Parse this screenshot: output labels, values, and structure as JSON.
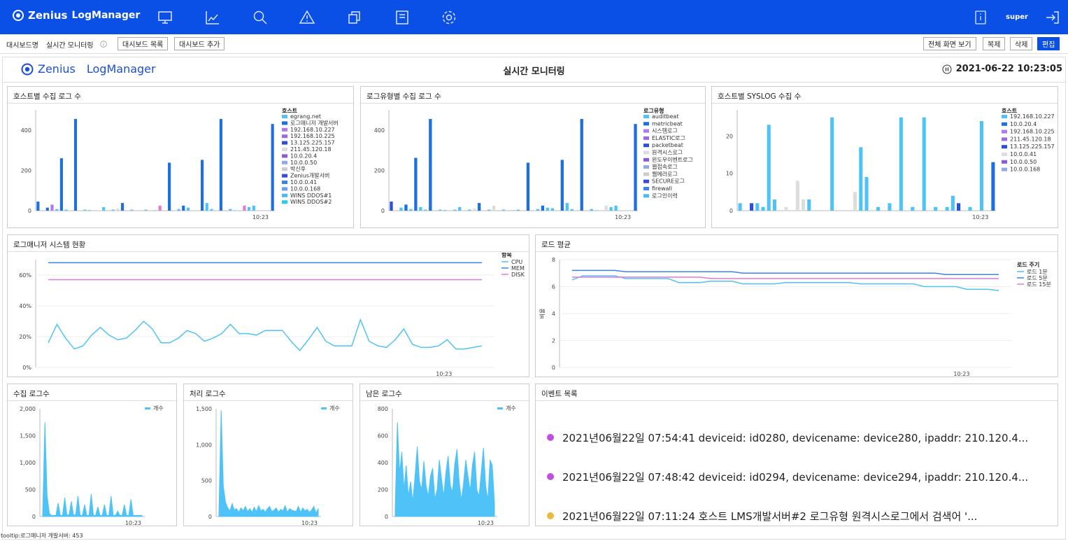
{
  "app": {
    "brand": "Zenius",
    "product": "LogManager",
    "user": "super",
    "accent": "#0a4fe6"
  },
  "nav_icons": [
    "monitor-icon",
    "line-chart-icon",
    "search-icon",
    "warning-icon",
    "copy-icon",
    "document-icon",
    "gear-icon"
  ],
  "toolbar": {
    "dashboard_label": "대시보드명",
    "dashboard_name": "실시간 모니터링",
    "list_button": "대시보드 목록",
    "add_button": "대시보드 추가",
    "fullscreen_button": "전체 화면 보기",
    "copy_button": "복제",
    "delete_button": "삭제",
    "edit_button": "편집"
  },
  "dashboard": {
    "logo_brand": "Zenius",
    "logo_product": "LogManager",
    "title": "실시간 모니터링",
    "datetime": "2021-06-22 10:23:05"
  },
  "panels": {
    "host_logs": "호스트별 수집 로그 수",
    "type_logs": "로그유형별 수집 로그 수",
    "syslog": "호스트별 SYSLOG 수집 수",
    "system": "로그매니저 시스템 현황",
    "load": "로드 평균",
    "collected": "수집 로그수",
    "processed": "처리 로그수",
    "remaining": "남은 로그수",
    "events": "이벤트 목록"
  },
  "events": [
    {
      "text": "2021년06월22일 07:54:41 deviceid: id0280, devicename: device280, ipaddr: 210.120.4...",
      "color": "#c04ee0"
    },
    {
      "text": "2021년06월22일 07:48:42 deviceid: id0294, devicename: device294, ipaddr: 210.120.4...",
      "color": "#c04ee0"
    },
    {
      "text": "2021년06월22일 07:11:24 호스트 LMS개발서버#2 로그유형 원격시스로그에서 검색어 '...",
      "color": "#f0b93a"
    }
  ],
  "tooltip": "tooltip:로그매니저 개발서버: 453",
  "chart_data": [
    {
      "id": "host_logs",
      "type": "bar",
      "xtick": "10:23",
      "ylim": [
        0,
        500
      ],
      "yticks": [
        0,
        200,
        400
      ],
      "legend_title": "호스트",
      "legend": [
        "egrang.net",
        "로그매니저 개발서버",
        "192.168.10.227",
        "192.168.10.225",
        "13.125.225.157",
        "211.45.120.18",
        "10.0.20.4",
        "10.0.0.50",
        "박신후",
        "Zenius개발서버",
        "10.0.0.41",
        "10.0.0.168",
        "WINS DDOS#1",
        "WINS DDOS#2"
      ],
      "legend_colors": [
        "#4fc3f7",
        "#1e6fe0",
        "#b07ae8",
        "#9b6be0",
        "#2a4fd9",
        "#dddddd",
        "#8a5ad8",
        "#8fa8e8",
        "#cccccc",
        "#3a4ae0",
        "#3a82f0",
        "#6aa0f0",
        "#4fb8f0",
        "#23d0e8"
      ],
      "values": [
        45,
        0,
        15,
        30,
        8,
        260,
        5,
        0,
        455,
        0,
        5,
        3,
        0,
        2,
        18,
        0,
        5,
        10,
        38,
        0,
        5,
        3,
        0,
        5,
        0,
        2,
        25,
        0,
        238,
        0,
        8,
        25,
        15,
        0,
        0,
        252,
        38,
        8,
        0,
        455,
        0,
        8,
        2,
        0,
        25,
        18,
        25,
        0,
        0,
        0,
        430
      ],
      "colors": [
        "#1e6fe0",
        "#fff",
        "#1e6fe0",
        "#b07ae8",
        "#4fc3f7",
        "#1e6fe0",
        "#4fc3f7",
        "#fff",
        "#1e6fe0",
        "#fff",
        "#4fc3f7",
        "#4fc3f7",
        "#fff",
        "#dddddd",
        "#4fc3f7",
        "#fff",
        "#4fc3f7",
        "#dddddd",
        "#1e6fe0",
        "#fff",
        "#4fc3f7",
        "#dddddd",
        "#fff",
        "#4fc3f7",
        "#fff",
        "#4fc3f7",
        "#e07ad8",
        "#fff",
        "#1e6fe0",
        "#fff",
        "#4fc3f7",
        "#1e6fe0",
        "#4fc3f7",
        "#fff",
        "#fff",
        "#1e6fe0",
        "#4fc3f7",
        "#4fc3f7",
        "#fff",
        "#1e6fe0",
        "#fff",
        "#4fc3f7",
        "#4fc3f7",
        "#fff",
        "#e07ad8",
        "#4fc3f7",
        "#4fc3f7",
        "#fff",
        "#fff",
        "#fff",
        "#1e6fe0"
      ]
    },
    {
      "id": "type_logs",
      "type": "bar",
      "xtick": "10:23",
      "ylim": [
        0,
        500
      ],
      "yticks": [
        0,
        200,
        400
      ],
      "legend_title": "로그유형",
      "legend": [
        "auditbeat",
        "metricbeat",
        "시스템로그",
        "ELASTIC로그",
        "packetbeat",
        "원격시스로그",
        "윈도우이벤트로그",
        "웹접속로그",
        "웹에러로그",
        "SECURE로그",
        "firewall",
        "로그인이력"
      ],
      "legend_colors": [
        "#4fc3f7",
        "#1e6fe0",
        "#b07ae8",
        "#9b6be0",
        "#2a4fd9",
        "#dddddd",
        "#8a5ad8",
        "#8fa8e8",
        "#cccccc",
        "#3a4ae0",
        "#3a82f0",
        "#4fb8f0"
      ],
      "values": [
        45,
        0,
        15,
        30,
        8,
        262,
        18,
        5,
        455,
        0,
        5,
        3,
        0,
        5,
        18,
        0,
        5,
        10,
        38,
        0,
        5,
        25,
        0,
        5,
        0,
        2,
        5,
        0,
        238,
        0,
        8,
        25,
        15,
        12,
        0,
        252,
        38,
        8,
        0,
        455,
        0,
        8,
        2,
        0,
        25,
        18,
        25,
        0,
        0,
        0,
        430
      ],
      "colors": [
        "#2a4fd9",
        "#fff",
        "#4fc3f7",
        "#1e6fe0",
        "#4fc3f7",
        "#1e6fe0",
        "#4fc3f7",
        "#4fc3f7",
        "#1e6fe0",
        "#fff",
        "#4fc3f7",
        "#4fc3f7",
        "#fff",
        "#4fc3f7",
        "#4fc3f7",
        "#fff",
        "#4fc3f7",
        "#dddddd",
        "#1e6fe0",
        "#fff",
        "#4fc3f7",
        "#dddddd",
        "#fff",
        "#4fc3f7",
        "#fff",
        "#4fc3f7",
        "#4fc3f7",
        "#fff",
        "#1e6fe0",
        "#fff",
        "#4fc3f7",
        "#1e6fe0",
        "#4fc3f7",
        "#4fc3f7",
        "#fff",
        "#1e6fe0",
        "#4fc3f7",
        "#4fc3f7",
        "#fff",
        "#1e6fe0",
        "#fff",
        "#4fc3f7",
        "#4fc3f7",
        "#fff",
        "#dddddd",
        "#4fc3f7",
        "#4fc3f7",
        "#fff",
        "#fff",
        "#fff",
        "#1e6fe0"
      ]
    },
    {
      "id": "syslog",
      "type": "bar",
      "xtick": "10:23",
      "ylim": [
        0,
        27
      ],
      "yticks": [
        0,
        10,
        20
      ],
      "legend_title": "호스트",
      "legend": [
        "192.168.10.227",
        "10.0.20.4",
        "192.168.10.225",
        "211.45.120.18",
        "13.125.225.157",
        "10.0.0.41",
        "10.0.0.50",
        "10.0.0.168"
      ],
      "legend_colors": [
        "#4fc3f7",
        "#1e6fe0",
        "#b07ae8",
        "#9b6be0",
        "#2a4fd9",
        "#dddddd",
        "#8a5ad8",
        "#8fa8e8"
      ],
      "values": [
        2,
        0,
        2,
        2,
        1,
        23,
        3,
        0,
        1,
        0,
        8,
        3,
        3,
        0,
        0,
        0,
        25,
        0,
        0,
        0,
        5,
        17,
        9,
        0,
        1,
        0,
        2,
        0,
        25,
        0,
        1,
        0,
        25,
        0,
        1,
        0,
        1,
        4,
        2,
        0,
        1,
        0,
        24,
        0,
        13
      ],
      "colors": [
        "#4fc3f7",
        "#fff",
        "#2a4fd9",
        "#4fc3f7",
        "#4fc3f7",
        "#4fc3f7",
        "#4fc3f7",
        "#fff",
        "#dddddd",
        "#fff",
        "#dddddd",
        "#dddddd",
        "#4fc3f7",
        "#fff",
        "#fff",
        "#fff",
        "#4fc3f7",
        "#fff",
        "#fff",
        "#fff",
        "#dddddd",
        "#4fc3f7",
        "#4fc3f7",
        "#fff",
        "#4fc3f7",
        "#fff",
        "#4fc3f7",
        "#fff",
        "#4fc3f7",
        "#fff",
        "#4fc3f7",
        "#fff",
        "#4fc3f7",
        "#fff",
        "#4fc3f7",
        "#fff",
        "#4fc3f7",
        "#4fc3f7",
        "#2a4fd9",
        "#fff",
        "#4fc3f7",
        "#fff",
        "#4fc3f7",
        "#fff",
        "#1e6fe0"
      ]
    },
    {
      "id": "system",
      "type": "line",
      "xtick": "10:23",
      "ylim": [
        0,
        70
      ],
      "yticks": [
        "0%",
        "20%",
        "40%",
        "60%"
      ],
      "legend_title": "항목",
      "series": [
        {
          "name": "CPU",
          "color": "#4fc3f7",
          "values": [
            16,
            28,
            19,
            12,
            14,
            21,
            26,
            21,
            18,
            19,
            24,
            30,
            25,
            16,
            16,
            19,
            24,
            22,
            17,
            19,
            22,
            28,
            22,
            22,
            21,
            24,
            24,
            24,
            17,
            11,
            18,
            26,
            17,
            14,
            14,
            14,
            31,
            17,
            14,
            13,
            18,
            25,
            15,
            13,
            13,
            14,
            18,
            12,
            12,
            13,
            14
          ]
        },
        {
          "name": "MEM",
          "color": "#3a82f0",
          "values": [
            68,
            68,
            68,
            68,
            68,
            68,
            68,
            68,
            68,
            68,
            68,
            68,
            68,
            68,
            68,
            68,
            68,
            68,
            68,
            68,
            68,
            68,
            68,
            68,
            68,
            68,
            68,
            68,
            68,
            68,
            68,
            68,
            68,
            68,
            68,
            68,
            68,
            68,
            68,
            68,
            68,
            68,
            68,
            68,
            68,
            68,
            68,
            68,
            68,
            68,
            68
          ]
        },
        {
          "name": "DISK",
          "color": "#e07ad8",
          "values": [
            57,
            57,
            57,
            57,
            57,
            57,
            57,
            57,
            57,
            57,
            57,
            57,
            57,
            57,
            57,
            57,
            57,
            57,
            57,
            57,
            57,
            57,
            57,
            57,
            57,
            57,
            57,
            57,
            57,
            57,
            57,
            57,
            57,
            57,
            57,
            57,
            57,
            57,
            57,
            57,
            57,
            57,
            57,
            57,
            57,
            57,
            57,
            57,
            57,
            57,
            57
          ]
        }
      ]
    },
    {
      "id": "load",
      "type": "line",
      "xtick": "10:23",
      "ylabel": "비율",
      "ylim": [
        0,
        8
      ],
      "yticks": [
        0,
        2,
        4,
        6,
        8
      ],
      "legend_title": "로드 주기",
      "series": [
        {
          "name": "로드 1분",
          "color": "#4fc3f7",
          "values": [
            6.5,
            6.8,
            6.8,
            6.8,
            6.8,
            6.6,
            6.6,
            6.6,
            6.6,
            6.6,
            6.3,
            6.3,
            6.3,
            6.4,
            6.4,
            6.4,
            6.2,
            6.2,
            6.2,
            6.2,
            6.3,
            6.3,
            6.3,
            6.3,
            6.3,
            6.3,
            6.3,
            6.2,
            6.2,
            6.2,
            6.2,
            6.2,
            6.2,
            6.0,
            6.0,
            6.0,
            6.0,
            5.8,
            5.8,
            5.8,
            5.7
          ]
        },
        {
          "name": "로드 5분",
          "color": "#3a82f0",
          "values": [
            7.2,
            7.2,
            7.2,
            7.2,
            7.2,
            7.1,
            7.1,
            7.1,
            7.1,
            7.1,
            7.1,
            7.1,
            7.1,
            7.1,
            7.1,
            7.1,
            7.0,
            7.0,
            7.0,
            7.0,
            7.0,
            7.0,
            7.0,
            7.0,
            7.0,
            7.0,
            7.0,
            7.0,
            7.0,
            7.0,
            7.0,
            7.0,
            7.0,
            7.0,
            7.0,
            6.9,
            6.9,
            6.9,
            6.9,
            6.9,
            6.9
          ]
        },
        {
          "name": "로드 15분",
          "color": "#e07ad8",
          "values": [
            6.7,
            6.7,
            6.7,
            6.7,
            6.7,
            6.7,
            6.7,
            6.7,
            6.7,
            6.7,
            6.7,
            6.7,
            6.7,
            6.6,
            6.6,
            6.6,
            6.6,
            6.6,
            6.6,
            6.6,
            6.6,
            6.6,
            6.6,
            6.6,
            6.6,
            6.6,
            6.6,
            6.6,
            6.6,
            6.6,
            6.6,
            6.6,
            6.6,
            6.6,
            6.6,
            6.6,
            6.6,
            6.6,
            6.6,
            6.6,
            6.6
          ]
        }
      ]
    },
    {
      "id": "collected",
      "type": "area",
      "xtick": "10:23",
      "ylim": [
        0,
        2000
      ],
      "yticks": [
        "0",
        "500",
        "1,000",
        "1,500",
        "2,000"
      ],
      "legend": [
        "개수"
      ],
      "color": "#4fc3f7",
      "values": [
        20,
        1750,
        400,
        60,
        20,
        20,
        20,
        250,
        20,
        20,
        350,
        20,
        40,
        280,
        20,
        40,
        380,
        20,
        20,
        220,
        20,
        20,
        420,
        20,
        20,
        180,
        20,
        20,
        220,
        20,
        20,
        380,
        20,
        20,
        100,
        20,
        20,
        220,
        20,
        20,
        320,
        20,
        20,
        20,
        20,
        20
      ]
    },
    {
      "id": "processed",
      "type": "area",
      "xtick": "10:23",
      "ylim": [
        0,
        1500
      ],
      "yticks": [
        "0",
        "500",
        "1,000",
        "1,500"
      ],
      "legend": [
        "개수"
      ],
      "color": "#4fc3f7",
      "values": [
        30,
        1480,
        420,
        200,
        120,
        80,
        180,
        90,
        110,
        60,
        120,
        80,
        140,
        70,
        110,
        60,
        130,
        70,
        150,
        80,
        100,
        60,
        110,
        140,
        70,
        90,
        120,
        60,
        100,
        80,
        150,
        60,
        110,
        90,
        80,
        70,
        140,
        60,
        120,
        80,
        100,
        60,
        90,
        140,
        50,
        110
      ]
    },
    {
      "id": "remaining",
      "type": "area",
      "xtick": "10:23",
      "ylim": [
        0,
        800
      ],
      "yticks": [
        "0",
        "200",
        "400",
        "600",
        "800"
      ],
      "legend": [
        "개수"
      ],
      "color": "#4fc3f7",
      "values": [
        50,
        700,
        320,
        480,
        200,
        380,
        150,
        260,
        110,
        300,
        520,
        260,
        200,
        410,
        230,
        150,
        300,
        360,
        130,
        200,
        420,
        280,
        150,
        330,
        450,
        230,
        180,
        390,
        500,
        260,
        120,
        250,
        420,
        300,
        190,
        380,
        480,
        200,
        150,
        330,
        510,
        230,
        120,
        420,
        380,
        100
      ]
    }
  ]
}
